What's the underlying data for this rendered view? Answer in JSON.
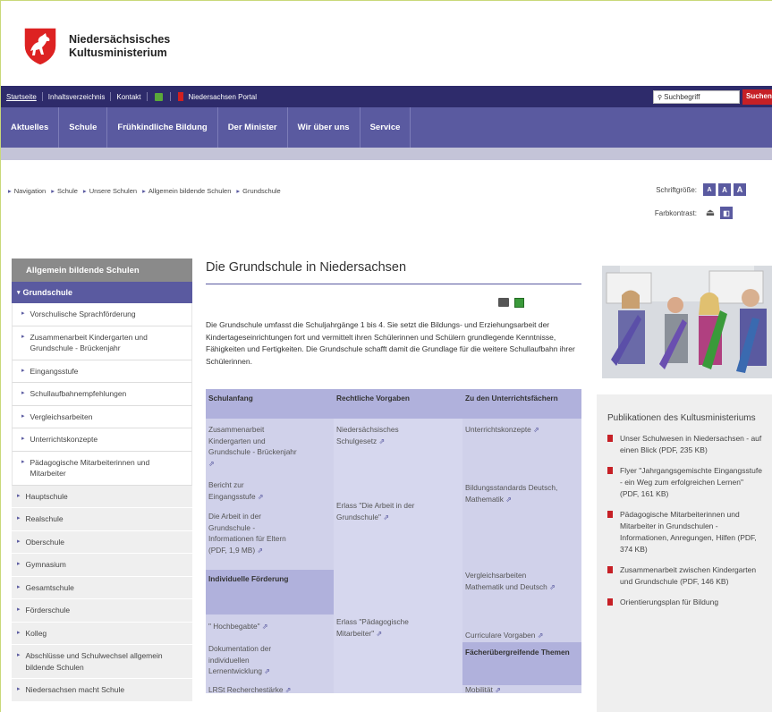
{
  "header": {
    "org_line1": "Niedersächsisches",
    "org_line2": "Kultusministerium"
  },
  "topbar": {
    "startseite": "Startseite",
    "inhaltsverzeichnis": "Inhaltsverzeichnis",
    "kontakt": "Kontakt",
    "portal": "Niedersachsen Portal",
    "search_placeholder": "Suchbegriff",
    "search_button": "Suchen"
  },
  "mainnav": [
    "Aktuelles",
    "Schule",
    "Frühkindliche Bildung",
    "Der Minister",
    "Wir über uns",
    "Service"
  ],
  "breadcrumb": [
    "Navigation",
    "Schule",
    "Unsere Schulen",
    "Allgemein bildende Schulen",
    "Grundschule"
  ],
  "tools": {
    "schriftgroesse": "Schriftgröße:",
    "farbkontrast": "Farbkontrast:",
    "size_buttons": [
      "A",
      "A",
      "A"
    ]
  },
  "leftnav": {
    "heading": "Allgemein bildende Schulen",
    "active": "Grundschule",
    "sub_items": [
      "Vorschulische Sprachförderung",
      "Zusammenarbeit Kindergarten und Grundschule - Brückenjahr",
      "Eingangsstufe",
      "Schullaufbahnempfehlungen",
      "Vergleichsarbeiten",
      "Unterrichtskonzepte",
      "Pädagogische Mitarbeiterinnen und Mitarbeiter"
    ],
    "main_items": [
      "Hauptschule",
      "Realschule",
      "Oberschule",
      "Gymnasium",
      "Gesamtschule",
      "Förderschule",
      "Kolleg",
      "Abschlüsse und Schulwechsel allgemein bildende Schulen",
      "Niedersachsen macht Schule"
    ]
  },
  "content": {
    "title": "Die Grundschule in Niedersachsen",
    "intro": "Die Grundschule umfasst die Schuljahrgänge 1 bis 4. Sie setzt die Bildungs- und Erziehungsarbeit der Kindertageseinrichtungen fort und vermittelt ihren Schülerinnen und Schülern grundlegende Kenntnisse, Fähigkeiten und Fertigkeiten. Die Grundschule schafft damit die Grundlage für die weitere Schullaufbahn ihrer Schülerinnen.",
    "table": {
      "headers": [
        "Schulanfang",
        "Rechtliche Vorgaben",
        "Zu den Unterrichtsfächern"
      ],
      "c1": [
        "Zusammenarbeit Kindergarten und Grundschule - Brückenjahr",
        "Bericht zur Eingangsstufe",
        "Die Arbeit in der Grundschule - Informationen für Eltern (PDF, 1,9 MB)",
        "Individuelle Förderung",
        "\" Hochbegabte\"",
        "Dokumentation der individuellen Lernentwicklung",
        "LRSt Recherchestärke"
      ],
      "c2": [
        "Niedersächsisches Schulgesetz",
        "Erlass \"Die Arbeit in der Grundschule\"",
        "Erlass \"Pädagogische Mitarbeiter\""
      ],
      "c3": [
        "Unterrichtskonzepte",
        "Bildungsstandards Deutsch, Mathematik",
        "Vergleichsarbeiten Mathematik und Deutsch",
        "Curriculare Vorgaben",
        "Fächerübergreifende Themen",
        "Mobilität"
      ]
    }
  },
  "publications": {
    "title": "Publikationen des Kultusministeriums",
    "items": [
      "Unser Schulwesen in Niedersachsen - auf einen Blick (PDF, 235 KB)",
      "Flyer \"Jahrgangsgemischte Eingangsstufe - ein Weg zum erfolgreichen Lernen\" (PDF, 161 KB)",
      "Pädagogische Mitarbeiterinnen und Mitarbeiter in Grundschulen - Informationen, Anregungen, Hilfen (PDF, 374 KB)",
      "Zusammenarbeit zwischen Kindergarten und Grundschule (PDF, 146 KB)",
      "Orientierungsplan für Bildung"
    ]
  },
  "colors": {
    "brand_dark": "#2e2b6b",
    "brand": "#5a5aa0",
    "table_bg": "#c8c9e8",
    "accent_red": "#c62026"
  }
}
